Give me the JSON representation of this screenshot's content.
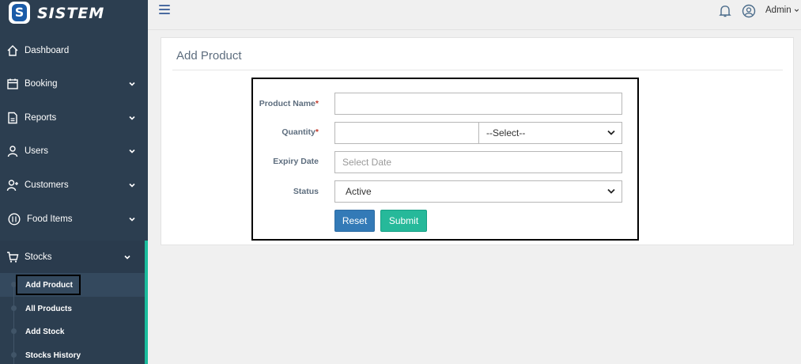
{
  "app": {
    "logo_letter": "S",
    "name": "SISTEM"
  },
  "sidebar": {
    "items": [
      {
        "label": "Dashboard",
        "icon": "home-icon"
      },
      {
        "label": "Booking",
        "icon": "calendar-icon"
      },
      {
        "label": "Reports",
        "icon": "document-icon"
      },
      {
        "label": "Users",
        "icon": "user-icon"
      },
      {
        "label": "Customers",
        "icon": "add-user-icon"
      },
      {
        "label": "Food Items",
        "icon": "food-icon"
      },
      {
        "label": "Stocks",
        "icon": "cart-icon"
      }
    ],
    "sub_items": [
      {
        "label": "Add Product"
      },
      {
        "label": "All Products"
      },
      {
        "label": "Add Stock"
      },
      {
        "label": "Stocks History"
      }
    ]
  },
  "topbar": {
    "user_label": "Admin"
  },
  "page": {
    "title": "Add Product"
  },
  "form": {
    "product_name_label": "Product Name",
    "quantity_label": "Quantity",
    "required_mark": "*",
    "unit_select_value": "--Select--",
    "expiry_label": "Expiry Date",
    "expiry_placeholder": "Select Date",
    "status_label": "Status",
    "status_value": "Active",
    "reset_label": "Reset",
    "submit_label": "Submit"
  },
  "colors": {
    "sidebar_bg": "#2c3e50",
    "accent": "#1abc9c",
    "reset_button": "#337ab7",
    "submit_button": "#26b99a",
    "required": "#c0392b"
  }
}
